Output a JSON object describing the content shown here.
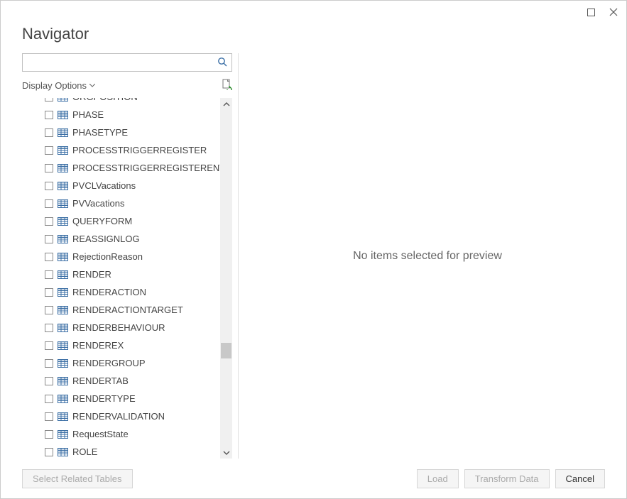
{
  "window": {
    "title": "Navigator"
  },
  "search": {
    "value": "",
    "placeholder": ""
  },
  "options": {
    "label": "Display Options"
  },
  "tree": {
    "items": [
      {
        "label": "ORGPOSITION"
      },
      {
        "label": "PHASE"
      },
      {
        "label": "PHASETYPE"
      },
      {
        "label": "PROCESSTRIGGERREGISTER"
      },
      {
        "label": "PROCESSTRIGGERREGISTERENT"
      },
      {
        "label": "PVCLVacations"
      },
      {
        "label": "PVVacations"
      },
      {
        "label": "QUERYFORM"
      },
      {
        "label": "REASSIGNLOG"
      },
      {
        "label": "RejectionReason"
      },
      {
        "label": "RENDER"
      },
      {
        "label": "RENDERACTION"
      },
      {
        "label": "RENDERACTIONTARGET"
      },
      {
        "label": "RENDERBEHAVIOUR"
      },
      {
        "label": "RENDEREX"
      },
      {
        "label": "RENDERGROUP"
      },
      {
        "label": "RENDERTAB"
      },
      {
        "label": "RENDERTYPE"
      },
      {
        "label": "RENDERVALIDATION"
      },
      {
        "label": "RequestState"
      },
      {
        "label": "ROLE"
      }
    ]
  },
  "preview": {
    "empty_text": "No items selected for preview"
  },
  "buttons": {
    "select_related": "Select Related Tables",
    "load": "Load",
    "transform": "Transform Data",
    "cancel": "Cancel"
  }
}
